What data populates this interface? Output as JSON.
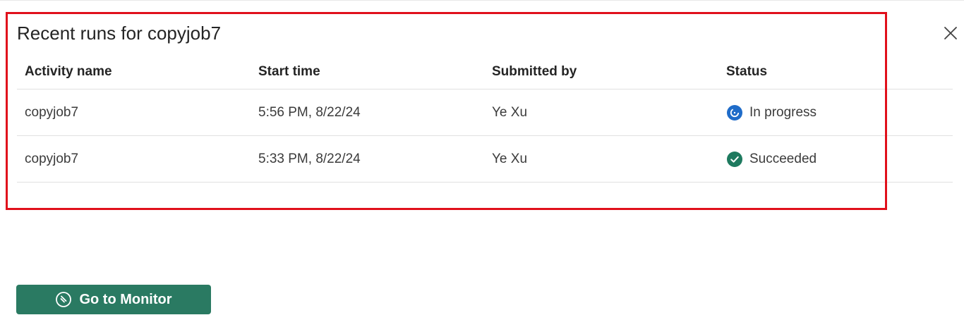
{
  "panel": {
    "title": "Recent runs for copyjob7"
  },
  "table": {
    "columns": [
      "Activity name",
      "Start time",
      "Submitted by",
      "Status"
    ],
    "rows": [
      {
        "activity": "copyjob7",
        "start": "5:56 PM, 8/22/24",
        "submitted_by": "Ye Xu",
        "status": "In progress",
        "status_icon": "in-progress-icon",
        "status_color": "#1f6cc9"
      },
      {
        "activity": "copyjob7",
        "start": "5:33 PM, 8/22/24",
        "submitted_by": "Ye Xu",
        "status": "Succeeded",
        "status_icon": "success-check-icon",
        "status_color": "#1e7a5f"
      }
    ]
  },
  "footer": {
    "monitor_button_label": "Go to Monitor",
    "monitor_button_color": "#2a7a62"
  },
  "colors": {
    "highlight_border": "#e0101b"
  }
}
